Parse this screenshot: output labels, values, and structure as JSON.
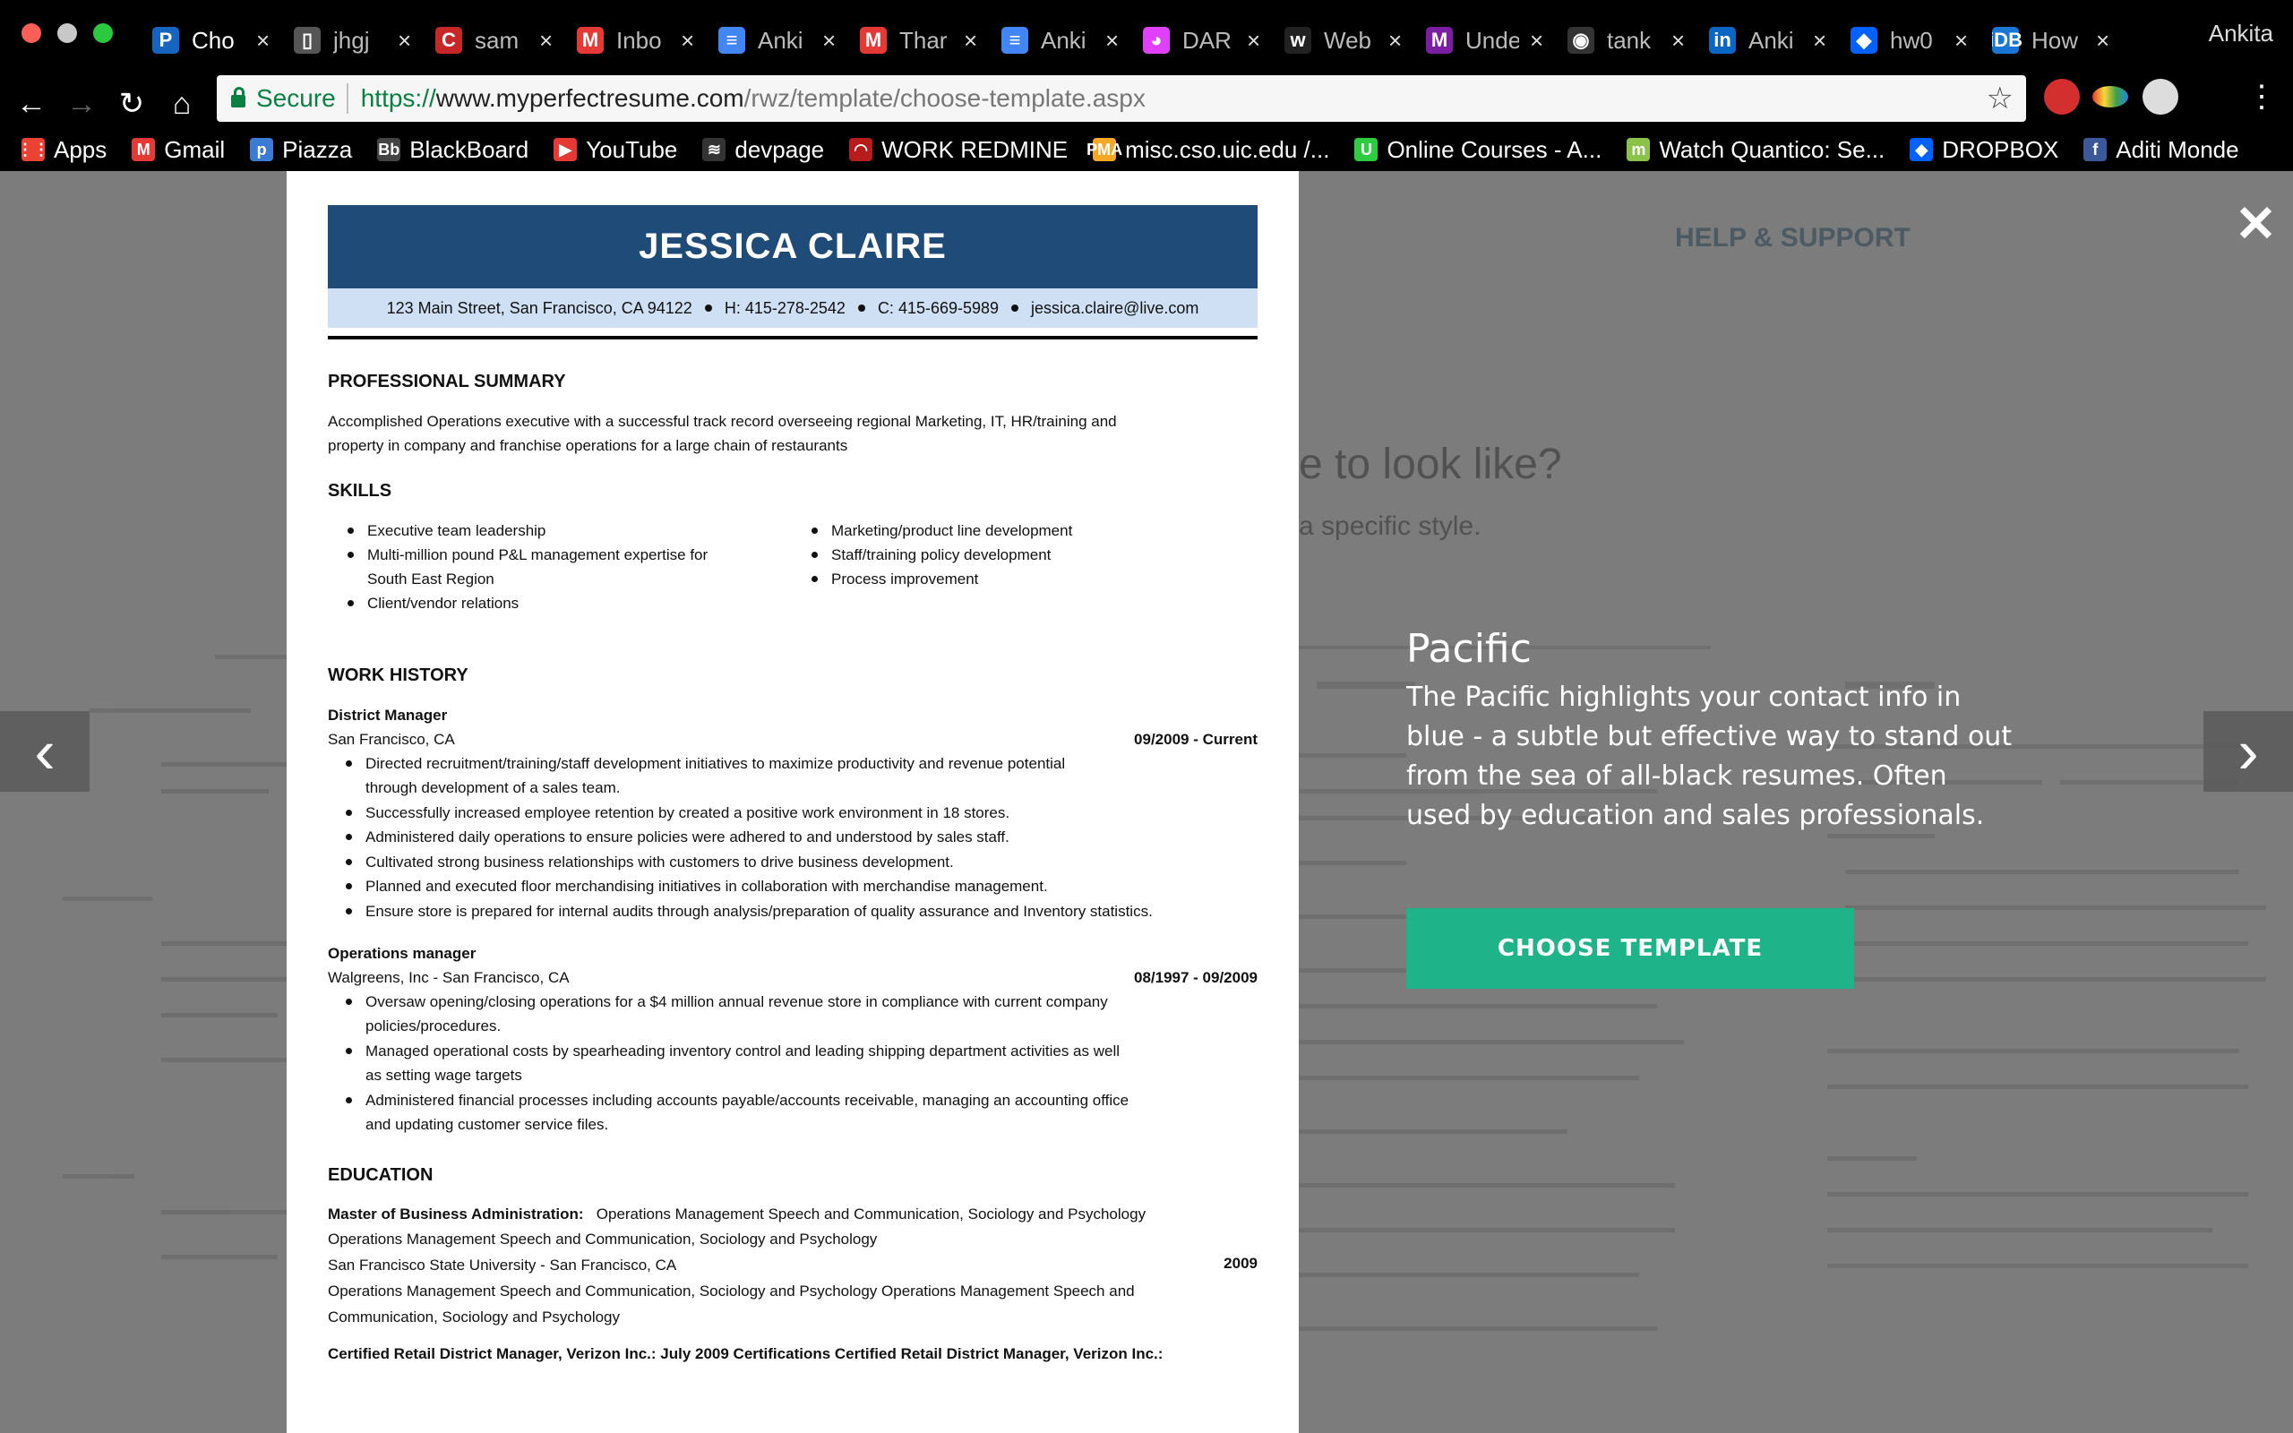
{
  "browser": {
    "tabs": [
      {
        "title": "Cho",
        "icon": "P",
        "color": "#1565c0",
        "active": true
      },
      {
        "title": "jhgj",
        "icon": "▯",
        "color": "#555555"
      },
      {
        "title": "sam",
        "icon": "C",
        "color": "#c62828"
      },
      {
        "title": "Inbo",
        "icon": "M",
        "color": "#e53935"
      },
      {
        "title": "Anki",
        "icon": "≡",
        "color": "#4285f4"
      },
      {
        "title": "Thar",
        "icon": "M",
        "color": "#e53935"
      },
      {
        "title": "Anki",
        "icon": "≡",
        "color": "#4285f4"
      },
      {
        "title": "DAR",
        "icon": "◕",
        "color": "#e040fb"
      },
      {
        "title": "Web",
        "icon": "w",
        "color": "#222222"
      },
      {
        "title": "Unde",
        "icon": "M",
        "color": "#7b1fa2"
      },
      {
        "title": "tank",
        "icon": "◉",
        "color": "#333333"
      },
      {
        "title": "Anki",
        "icon": "in",
        "color": "#0a66c2"
      },
      {
        "title": "hw0",
        "icon": "◆",
        "color": "#0061fe"
      },
      {
        "title": "How",
        "icon": "iDB",
        "color": "#1976d2"
      }
    ],
    "profile": "Ankita",
    "url": {
      "secure_label": "Secure",
      "scheme": "https://",
      "host": "www.myperfectresume.com",
      "path": "/rwz/template/choose-template.aspx"
    },
    "bookmarks": [
      {
        "label": "Apps",
        "icon": "⋮⋮",
        "color": "#ea4335"
      },
      {
        "label": "Gmail",
        "icon": "M",
        "color": "#e53935"
      },
      {
        "label": "Piazza",
        "icon": "p",
        "color": "#3a7bd5"
      },
      {
        "label": "BlackBoard",
        "icon": "Bb",
        "color": "#444444"
      },
      {
        "label": "YouTube",
        "icon": "▶",
        "color": "#e53935"
      },
      {
        "label": "devpage",
        "icon": "≋",
        "color": "#333333"
      },
      {
        "label": "WORK REDMINE",
        "icon": "◠",
        "color": "#b71c1c"
      },
      {
        "label": "misc.cso.uic.edu /...",
        "icon": "PMA",
        "color": "#f9a825"
      },
      {
        "label": "Online Courses - A...",
        "icon": "U",
        "color": "#2ecc40"
      },
      {
        "label": "Watch Quantico: Se...",
        "icon": "m",
        "color": "#8bc34a"
      },
      {
        "label": "DROPBOX",
        "icon": "◆",
        "color": "#0061fe"
      },
      {
        "label": "Aditi Monde",
        "icon": "f",
        "color": "#3b5998"
      }
    ]
  },
  "background": {
    "help_label": "HELP & SUPPORT",
    "hero_title": "e to look like?",
    "hero_sub": "a specific style."
  },
  "resume": {
    "name": "JESSICA CLAIRE",
    "contact": {
      "address": "123 Main Street, San Francisco, CA 94122",
      "home": "H: 415-278-2542",
      "cell": "C: 415-669-5989",
      "email": "jessica.claire@live.com"
    },
    "summary_heading": "PROFESSIONAL SUMMARY",
    "summary_line1": "Accomplished Operations executive with a successful track record overseeing regional Marketing, IT, HR/training and",
    "summary_line2": "property in company and franchise operations for a large chain of restaurants",
    "skills_heading": "SKILLS",
    "skills_left": [
      "Executive team leadership",
      "Multi-million pound P&L management expertise for",
      "Client/vendor relations"
    ],
    "skills_left_cont": "South East Region",
    "skills_right": [
      "Marketing/product line development",
      "Staff/training policy development",
      "Process improvement"
    ],
    "work_heading": "WORK HISTORY",
    "job1": {
      "title": "District Manager",
      "place": "San Francisco, CA",
      "dates": "09/2009 - Current",
      "bullets": [
        "Directed recruitment/training/staff development initiatives to maximize productivity and revenue potential",
        "Successfully increased employee retention by created a positive work environment in 18 stores.",
        "Administered daily operations to ensure policies were adhered to and understood by sales staff.",
        "Cultivated strong business relationships with customers to drive business development.",
        "Planned and executed floor merchandising initiatives in collaboration with merchandise management.",
        "Ensure store is prepared for internal audits through analysis/preparation of quality assurance and Inventory statistics."
      ],
      "bullet1_cont": "through development of a sales team."
    },
    "job2": {
      "title": "Operations manager",
      "place": "Walgreens, Inc - San Francisco, CA",
      "dates": "08/1997 - 09/2009",
      "bullets": [
        "Oversaw opening/closing operations for a $4 million annual revenue store in compliance with current company",
        "Managed operational costs by spearheading inventory control and leading shipping department activities as well",
        "Administered financial processes including accounts payable/accounts receivable, managing an accounting office"
      ],
      "conts": [
        "policies/procedures.",
        "as setting wage targets",
        "and updating customer service files."
      ]
    },
    "edu_heading": "EDUCATION",
    "edu": {
      "degree": "Master of Business Administration:",
      "degree_field": "Operations Management Speech and Communication, Sociology and Psychology",
      "line2": "Operations Management Speech and Communication, Sociology and Psychology",
      "school": "San Francisco State University - San Francisco, CA",
      "year": "2009",
      "line4": "Operations Management Speech and Communication, Sociology and Psychology Operations Management Speech and",
      "line5": "Communication, Sociology and Psychology",
      "cert": "Certified Retail District Manager, Verizon Inc.: July 2009 Certifications Certified Retail District Manager, Verizon Inc.:"
    }
  },
  "detail": {
    "title": "Pacific",
    "description": "The Pacific highlights your contact info in blue - a subtle but effective way to stand out from the sea of all-black resumes. Often used by education and sales professionals.",
    "button": "CHOOSE TEMPLATE"
  },
  "icons": {
    "close": "✕",
    "prev": "‹",
    "next": "›"
  }
}
